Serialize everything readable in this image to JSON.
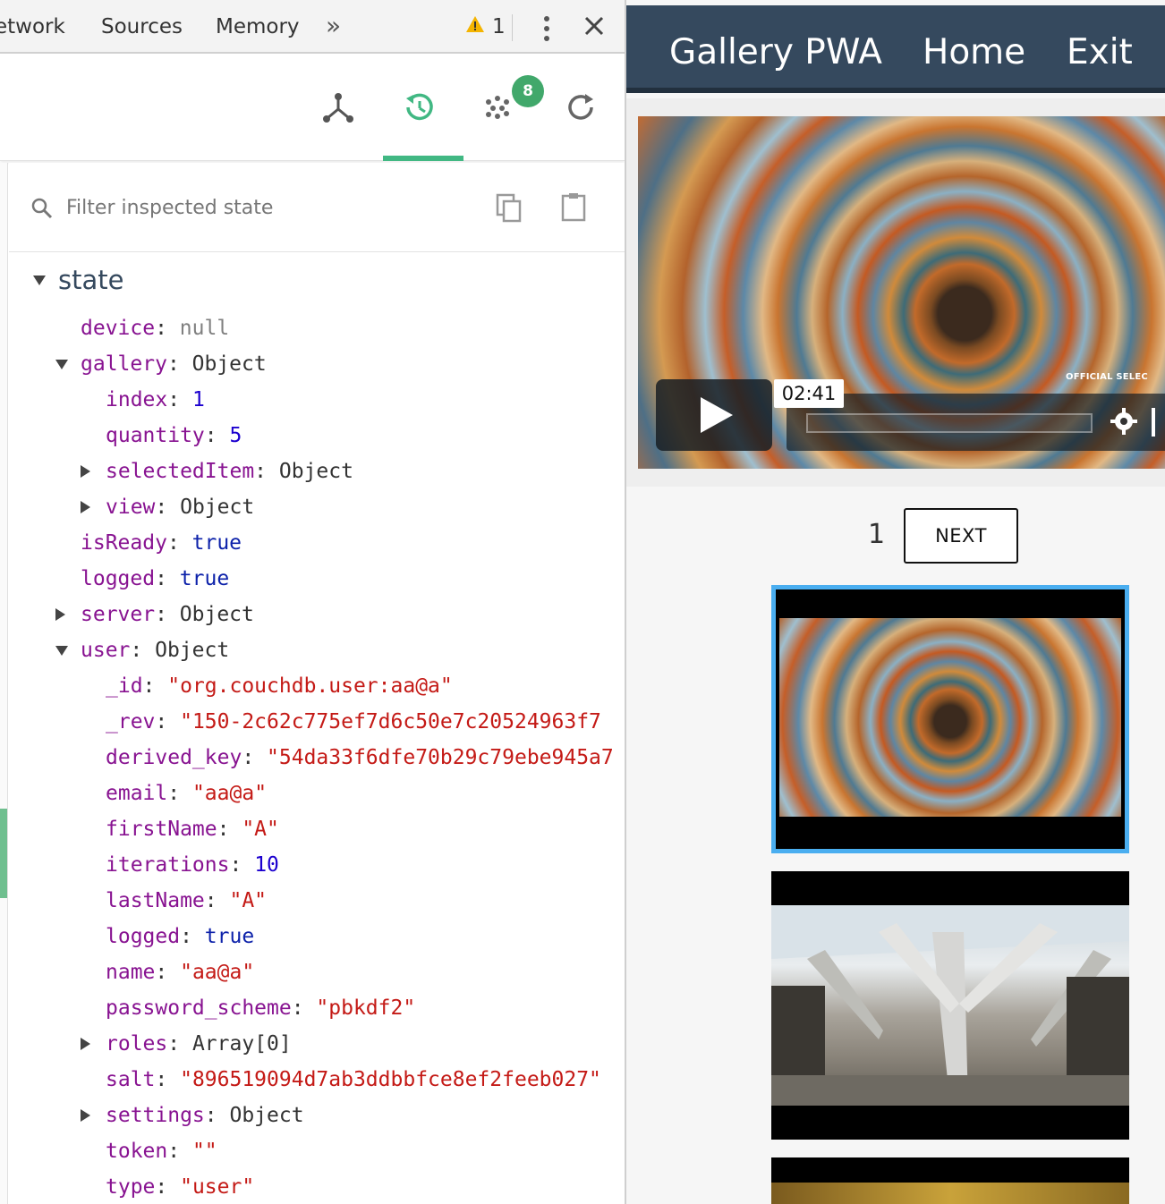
{
  "devtools": {
    "tabs": [
      "etwork",
      "Sources",
      "Memory"
    ],
    "more_tabs_glyph": "»",
    "warnings_count": "1",
    "toolbar": {
      "icons": [
        "components-icon",
        "vuex-history-icon",
        "events-icon",
        "refresh-icon"
      ],
      "events_badge": "8",
      "active_color": "#41b883"
    },
    "filter": {
      "placeholder": "Filter inspected state",
      "value": ""
    },
    "state": {
      "root_label": "state",
      "rows": [
        {
          "indent": 1,
          "arrow": "",
          "key": "device",
          "value": "null",
          "type": "null"
        },
        {
          "indent": 1,
          "arrow": "down",
          "key": "gallery",
          "value": "Object",
          "type": "obj"
        },
        {
          "indent": 2,
          "arrow": "",
          "key": "index",
          "value": "1",
          "type": "num"
        },
        {
          "indent": 2,
          "arrow": "",
          "key": "quantity",
          "value": "5",
          "type": "num"
        },
        {
          "indent": 2,
          "arrow": "right",
          "key": "selectedItem",
          "value": "Object",
          "type": "obj"
        },
        {
          "indent": 2,
          "arrow": "right",
          "key": "view",
          "value": "Object",
          "type": "obj"
        },
        {
          "indent": 1,
          "arrow": "",
          "key": "isReady",
          "value": "true",
          "type": "bool"
        },
        {
          "indent": 1,
          "arrow": "",
          "key": "logged",
          "value": "true",
          "type": "bool"
        },
        {
          "indent": 1,
          "arrow": "right",
          "key": "server",
          "value": "Object",
          "type": "obj"
        },
        {
          "indent": 1,
          "arrow": "down",
          "key": "user",
          "value": "Object",
          "type": "obj"
        },
        {
          "indent": 2,
          "arrow": "",
          "key": "_id",
          "value": "\"org.couchdb.user:aa@a\"",
          "type": "str"
        },
        {
          "indent": 2,
          "arrow": "",
          "key": "_rev",
          "value": "\"150-2c62c775ef7d6c50e7c20524963f7",
          "type": "str"
        },
        {
          "indent": 2,
          "arrow": "",
          "key": "derived_key",
          "value": "\"54da33f6dfe70b29c79ebe945a7",
          "type": "str"
        },
        {
          "indent": 2,
          "arrow": "",
          "key": "email",
          "value": "\"aa@a\"",
          "type": "str"
        },
        {
          "indent": 2,
          "arrow": "",
          "key": "firstName",
          "value": "\"A\"",
          "type": "str"
        },
        {
          "indent": 2,
          "arrow": "",
          "key": "iterations",
          "value": "10",
          "type": "num"
        },
        {
          "indent": 2,
          "arrow": "",
          "key": "lastName",
          "value": "\"A\"",
          "type": "str"
        },
        {
          "indent": 2,
          "arrow": "",
          "key": "logged",
          "value": "true",
          "type": "bool"
        },
        {
          "indent": 2,
          "arrow": "",
          "key": "name",
          "value": "\"aa@a\"",
          "type": "str"
        },
        {
          "indent": 2,
          "arrow": "",
          "key": "password_scheme",
          "value": "\"pbkdf2\"",
          "type": "str"
        },
        {
          "indent": 2,
          "arrow": "right",
          "key": "roles",
          "value": "Array[0]",
          "type": "obj"
        },
        {
          "indent": 2,
          "arrow": "",
          "key": "salt",
          "value": "\"896519094d7ab3ddbbfce8ef2feeb027\"",
          "type": "str"
        },
        {
          "indent": 2,
          "arrow": "right",
          "key": "settings",
          "value": "Object",
          "type": "obj"
        },
        {
          "indent": 2,
          "arrow": "",
          "key": "token",
          "value": "\"\"",
          "type": "str"
        },
        {
          "indent": 2,
          "arrow": "",
          "key": "type",
          "value": "\"user\"",
          "type": "str"
        }
      ]
    }
  },
  "app": {
    "header": {
      "brand": "Gallery PWA",
      "home": "Home",
      "exit": "Exit",
      "bg_color": "#35495e"
    },
    "video": {
      "time_tooltip": "02:41",
      "overlay_text": "OFFICIAL SELEC"
    },
    "pagination": {
      "current_page": "1",
      "next_label": "NEXT"
    },
    "thumbnails": [
      {
        "selected": true
      },
      {
        "selected": false
      },
      {
        "selected": false
      }
    ],
    "selected_border_color": "#4aaef0"
  }
}
